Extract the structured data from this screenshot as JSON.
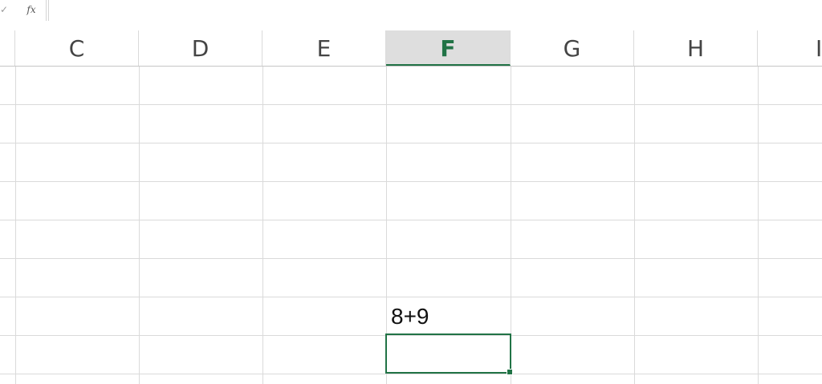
{
  "formula_bar": {
    "check_symbol": "✓",
    "fx_label": "fx",
    "value": ""
  },
  "columns": [
    {
      "label": "C",
      "selected": false
    },
    {
      "label": "D",
      "selected": false
    },
    {
      "label": "E",
      "selected": false
    },
    {
      "label": "F",
      "selected": true
    },
    {
      "label": "G",
      "selected": false
    },
    {
      "label": "H",
      "selected": false
    },
    {
      "label": "I",
      "selected": false
    }
  ],
  "cells": {
    "F_row6": "8+9",
    "F_row7": ""
  },
  "colors": {
    "accent": "#217346",
    "header_selected_bg": "#dedede",
    "gridline": "#dadada"
  }
}
